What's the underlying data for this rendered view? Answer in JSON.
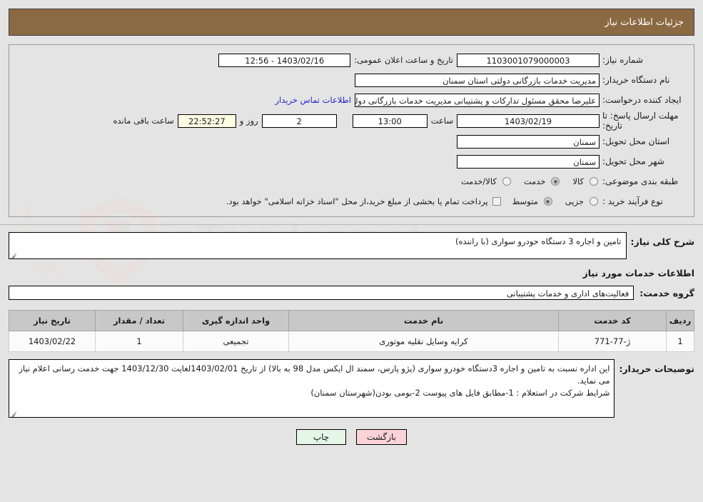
{
  "header": {
    "title": "جزئیات اطلاعات نیاز"
  },
  "info": {
    "need_number_label": "شماره نیاز:",
    "need_number_value": "1103001079000003",
    "public_announce_label": "تاریخ و ساعت اعلان عمومی:",
    "public_announce_value": "12:56 - 1403/02/16",
    "buyer_org_label": "نام دستگاه خریدار:",
    "buyer_org_value": "مدیریت خدمات بازرگانی دولتی استان سمنان",
    "creator_label": "ایجاد کننده درخواست:",
    "creator_value": "علیرضا محقق مسئول تدارکات و پشتیبانی مدیریت خدمات بازرگانی دولتی استان",
    "contact_link": "اطلاعات تماس خریدار",
    "deadline_label": "مهلت ارسال پاسخ: تا تاریخ:",
    "deadline_date": "1403/02/19",
    "hour_label": "ساعت",
    "deadline_time": "13:00",
    "days_value": "2",
    "days_label": "روز و",
    "countdown_value": "22:52:27",
    "countdown_label": "ساعت باقی مانده",
    "delivery_province_label": "استان محل تحویل:",
    "delivery_province_value": "سمنان",
    "delivery_city_label": "شهر محل تحویل:",
    "delivery_city_value": "سمنان",
    "category_label": "طبقه بندی موضوعی:",
    "category_options": [
      {
        "label": "کالا",
        "checked": false
      },
      {
        "label": "خدمت",
        "checked": true
      },
      {
        "label": "کالا/خدمت",
        "checked": false
      }
    ],
    "process_label": "نوع فرآیند خرید :",
    "process_options": [
      {
        "label": "جزیی",
        "checked": false
      },
      {
        "label": "متوسط",
        "checked": true
      }
    ],
    "treasury_checkbox_text": "پرداخت تمام یا بخشی از مبلغ خرید،از محل \"اسناد خزانه اسلامی\" خواهد بود.",
    "treasury_checked": false
  },
  "need_summary": {
    "label": "شرح کلی نیاز:",
    "value": "تامین و اجاره 3 دستگاه خودرو سواری (با راننده)"
  },
  "services_heading": "اطلاعات خدمات مورد نیاز",
  "service_group": {
    "label": "گروه خدمت:",
    "value": "فعالیت‌های اداری و خدمات پشتیبانی"
  },
  "items_table": {
    "columns": [
      "ردیف",
      "کد خدمت",
      "نام خدمت",
      "واحد اندازه گیری",
      "تعداد / مقدار",
      "تاریخ نیاز"
    ],
    "rows": [
      {
        "radif": "1",
        "code": "ژ-77-771",
        "name": "کرایه وسایل نقلیه موتوری",
        "unit": "تجمیعی",
        "qty": "1",
        "date": "1403/02/22"
      }
    ]
  },
  "buyer_notes": {
    "label": "توضیحات خریدار:",
    "lines": [
      "این اداره نسبت به تامین و اجاره 3دستگاه خودرو سواری (پژو پارس، سمند ال ایکس مدل 98 به بالا) از تاریخ 1403/02/01لغایت 1403/12/30 جهت خدمت رسانی اعلام نیاز می نماید.",
      "شرایط شرکت در استعلام : 1-مطابق فایل های پیوست 2-بومی بودن(شهرستان سمنان)"
    ]
  },
  "footer": {
    "print_label": "چاپ",
    "back_label": "بازگشت"
  },
  "watermark": {
    "text": "AriaTender.net"
  },
  "colors": {
    "header_bar": "#8b6a43",
    "page_background": "#e4e4e4",
    "link": "#2424cc",
    "countdown_background": "#fdfde4",
    "table_header": "#c8c8c8",
    "print_button": "#e6f6e6",
    "back_button": "#fbd3d6"
  }
}
